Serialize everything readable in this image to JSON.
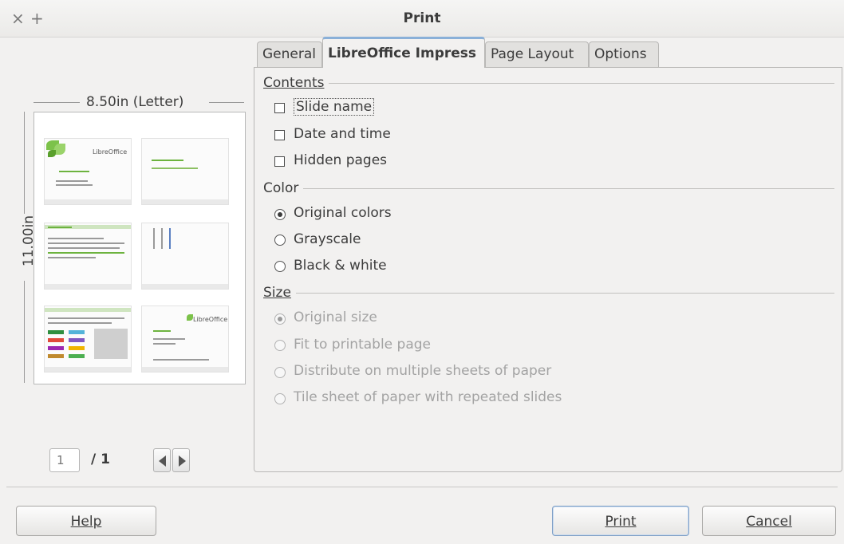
{
  "window": {
    "title": "Print",
    "close_glyph": "×",
    "maximize_glyph": "+"
  },
  "preview": {
    "width_label": "8.50in (Letter)",
    "height_label": "11.00in",
    "page_value": "1",
    "page_total": "/ 1",
    "thumb_texts": [
      "LibreOffice",
      "LibreOffice"
    ]
  },
  "tabs": [
    {
      "label": "General"
    },
    {
      "label": "LibreOffice Impress"
    },
    {
      "label": "Page Layout"
    },
    {
      "label": "Options"
    }
  ],
  "contents": {
    "title": "Contents",
    "options": [
      {
        "label": "Slide name",
        "checked": false
      },
      {
        "label": "Date and time",
        "checked": false
      },
      {
        "label": "Hidden pages",
        "checked": false
      }
    ]
  },
  "color": {
    "title": "Color",
    "options": [
      {
        "label": "Original colors",
        "selected": true
      },
      {
        "label": "Grayscale",
        "selected": false
      },
      {
        "label": "Black & white",
        "selected": false
      }
    ]
  },
  "size": {
    "title": "Size",
    "options": [
      {
        "label": "Original size",
        "selected": true
      },
      {
        "label": "Fit to printable page",
        "selected": false
      },
      {
        "label": "Distribute on multiple sheets of paper",
        "selected": false
      },
      {
        "label": "Tile sheet of paper with repeated slides",
        "selected": false
      }
    ]
  },
  "buttons": {
    "help": "Help",
    "print": "Print",
    "cancel": "Cancel"
  },
  "colors": {
    "accent": "#8ab0d8",
    "leaf_green": "#7cc24a",
    "window_bg": "#f2f1f0"
  }
}
